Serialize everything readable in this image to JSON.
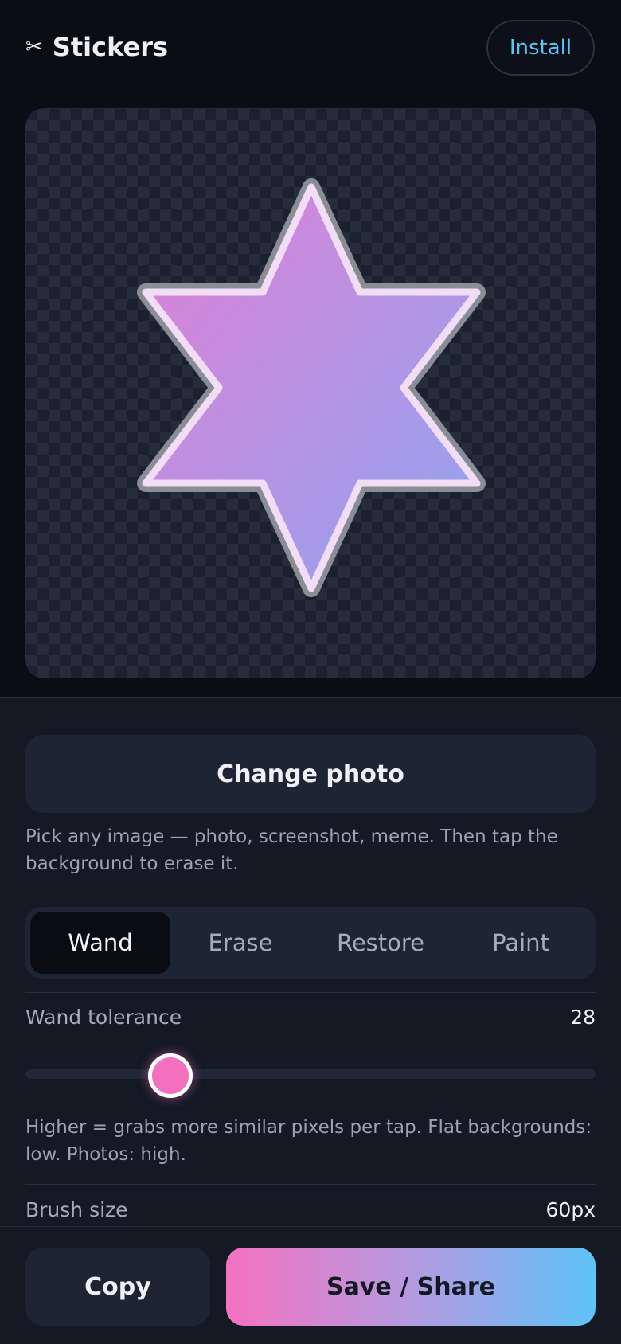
{
  "header": {
    "title": "Stickers",
    "icon": "scissors-icon",
    "install_label": "Install"
  },
  "canvas": {
    "subject": "six-point-star",
    "gradient": [
      "#e07fd6",
      "#8fa6f0"
    ]
  },
  "panel": {
    "change_photo_label": "Change photo",
    "change_photo_hint": "Pick any image — photo, screenshot, meme. Then tap the background to erase it.",
    "tabs": [
      {
        "label": "Wand",
        "active": true
      },
      {
        "label": "Erase",
        "active": false
      },
      {
        "label": "Restore",
        "active": false
      },
      {
        "label": "Paint",
        "active": false
      }
    ],
    "wand_tolerance": {
      "label": "Wand tolerance",
      "value": "28",
      "hint": "Higher = grabs more similar pixels per tap. Flat backgrounds: low. Photos: high."
    },
    "brush_size": {
      "label": "Brush size",
      "value": "60px"
    }
  },
  "actions": {
    "copy_label": "Copy",
    "save_label": "Save / Share"
  },
  "colors": {
    "accent_pink": "#f472c1",
    "accent_blue": "#5fc3f8",
    "install_text": "#5cc5f5",
    "background": "#0b0d14",
    "panel": "#141924"
  }
}
